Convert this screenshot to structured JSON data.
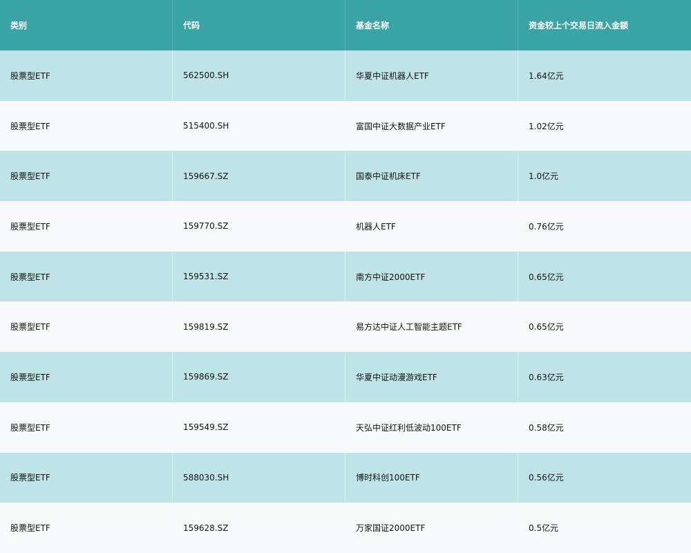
{
  "columns": [
    "类别",
    "代码",
    "基金名称",
    "资金较上个交易日流入金额"
  ],
  "rows": [
    [
      "股票型ETF",
      "562500.SH",
      "华夏中证机器人ETF",
      "1.64亿元"
    ],
    [
      "股票型ETF",
      "515400.SH",
      "富国中证大数据产业ETF",
      "1.02亿元"
    ],
    [
      "股票型ETF",
      "159667.SZ",
      "国泰中证机床ETF",
      "1.0亿元"
    ],
    [
      "股票型ETF",
      "159770.SZ",
      "机器人ETF",
      "0.76亿元"
    ],
    [
      "股票型ETF",
      "159531.SZ",
      "南方中证2000ETF",
      "0.65亿元"
    ],
    [
      "股票型ETF",
      "159819.SZ",
      "易方达中证人工智能主题ETF",
      "0.65亿元"
    ],
    [
      "股票型ETF",
      "159869.SZ",
      "华夏中证动漫游戏ETF",
      "0.63亿元"
    ],
    [
      "股票型ETF",
      "159549.SZ",
      "天弘中证红利低波动100ETF",
      "0.58亿元"
    ],
    [
      "股票型ETF",
      "588030.SH",
      "博时科创100ETF",
      "0.56亿元"
    ],
    [
      "股票型ETF",
      "159628.SZ",
      "万家国证2000ETF",
      "0.5亿元"
    ]
  ],
  "colors": {
    "header_bg": "#3aa3a3",
    "alt_row_bg": "#bee4ea",
    "plain_row_bg": "#f7f9fb"
  }
}
